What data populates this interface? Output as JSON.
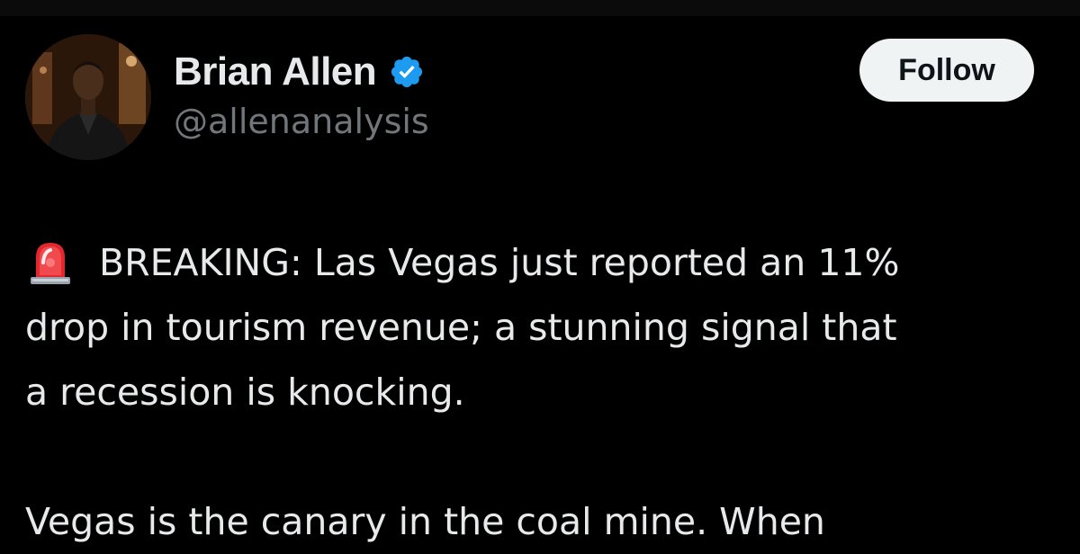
{
  "author": {
    "display_name": "Brian Allen",
    "handle": "@allenanalysis",
    "avatar_icon": "profile-photo",
    "verified_icon": "verified-badge-icon",
    "verified_color": "#1d9bf0"
  },
  "follow_button": {
    "label": "Follow"
  },
  "tweet": {
    "emoji_icon": "police-siren-icon",
    "paragraph1": [
      "BREAKING: Las Vegas just reported an 11%",
      "drop in tourism revenue; a stunning signal that",
      "a recession is knocking."
    ],
    "paragraph2": [
      "Vegas is the canary in the coal mine. When"
    ]
  },
  "colors": {
    "background": "#000000",
    "text": "#e7e9ea",
    "secondary_text": "#71767b",
    "button_bg": "#eff3f4",
    "button_text": "#0f1419"
  }
}
